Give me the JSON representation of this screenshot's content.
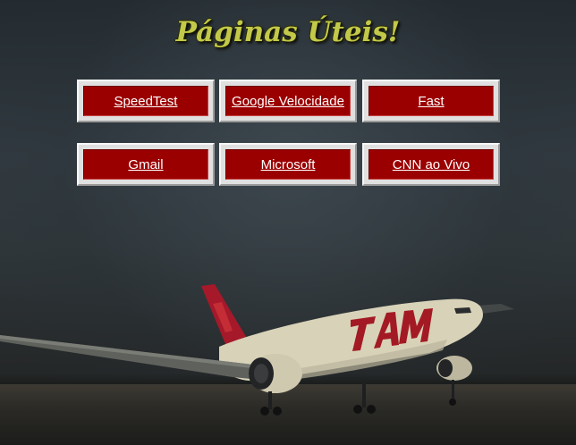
{
  "title": "Páginas Úteis!",
  "links": [
    {
      "label": "SpeedTest"
    },
    {
      "label": "Google Velocidade"
    },
    {
      "label": "Fast"
    },
    {
      "label": "Gmail"
    },
    {
      "label": "Microsoft"
    },
    {
      "label": "CNN ao Vivo"
    }
  ],
  "background": {
    "airline_livery": "TAM",
    "accent_color": "#9b0000",
    "title_color": "#c2c94a"
  }
}
